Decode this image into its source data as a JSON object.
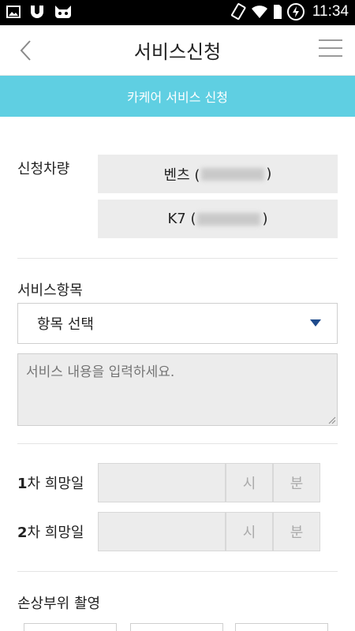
{
  "status_bar": {
    "time": "11:34",
    "left_icons": [
      "image-icon",
      "magnet-icon",
      "cat-icon"
    ],
    "right_icons": [
      "rotate-icon",
      "wifi-icon",
      "sim-icon",
      "battery-charging-icon"
    ]
  },
  "header": {
    "title": "서비스신청",
    "back_icon": "chevron-left-icon",
    "menu_icon": "hamburger-menu-icon"
  },
  "banner": {
    "text": "카케어 서비스 신청"
  },
  "vehicles": {
    "label": "신청차량",
    "items": [
      {
        "prefix": "벤츠 (",
        "suffix": ")"
      },
      {
        "prefix": "K7 (",
        "suffix": ")"
      }
    ]
  },
  "service": {
    "label": "서비스항목",
    "select_value": "항목 선택",
    "textarea_placeholder": "서비스 내용을 입력하세요."
  },
  "dates": {
    "rows": [
      {
        "num": "1",
        "label": "차 희망일",
        "hour": "시",
        "minute": "분"
      },
      {
        "num": "2",
        "label": "차 희망일",
        "hour": "시",
        "minute": "분"
      }
    ]
  },
  "photo": {
    "label": "손상부위 촬영"
  },
  "colors": {
    "banner": "#5fcfe2",
    "box_grey": "#ececec",
    "caret": "#1f4b8c"
  }
}
